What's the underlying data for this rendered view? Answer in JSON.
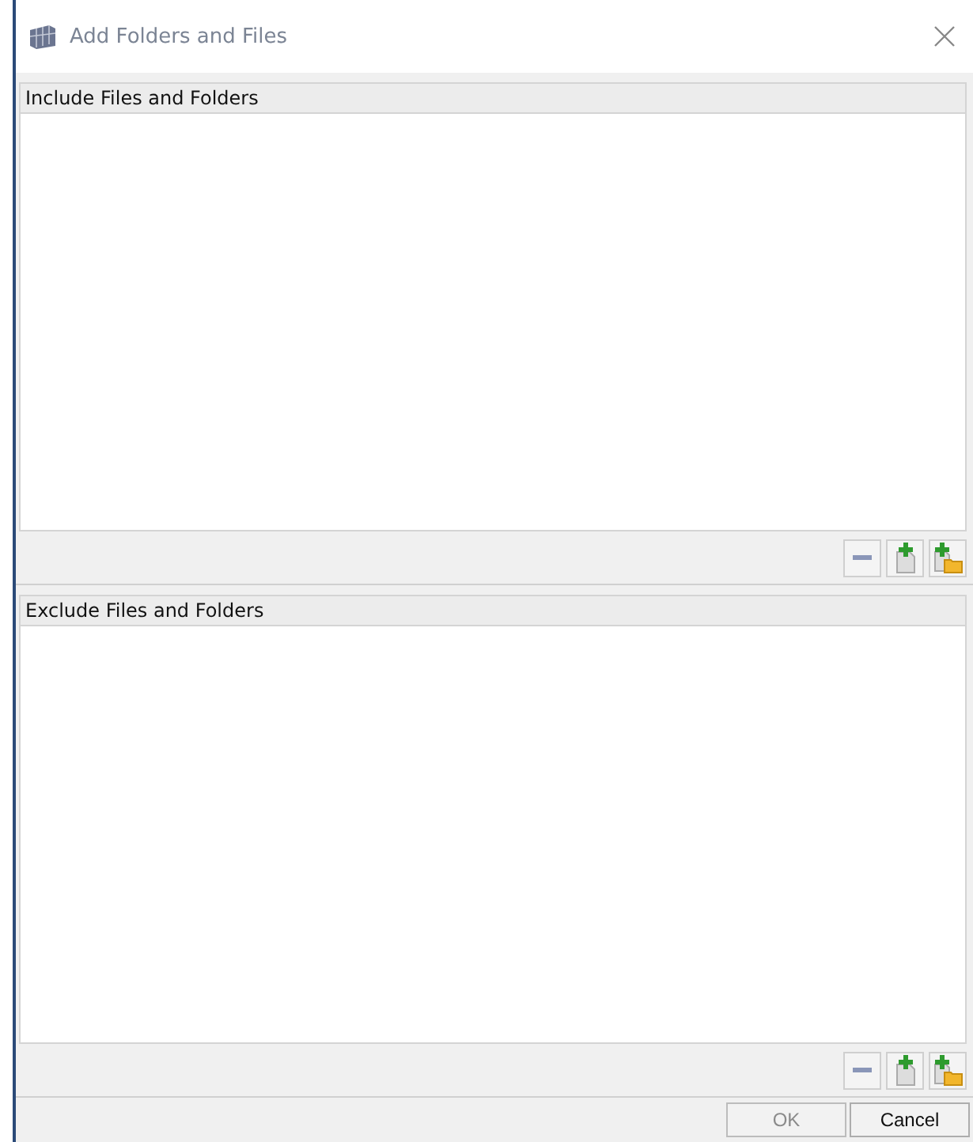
{
  "window": {
    "title": "Add Folders and Files"
  },
  "sections": [
    {
      "header": "Include Files and Folders"
    },
    {
      "header": "Exclude Files and Folders"
    }
  ],
  "buttons": [
    {
      "label": "OK",
      "disabled": true
    },
    {
      "label": "Cancel",
      "disabled": false
    }
  ]
}
